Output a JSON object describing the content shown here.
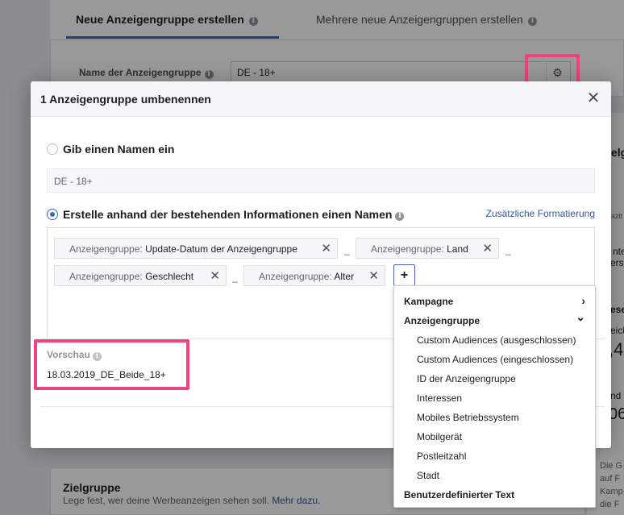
{
  "background": {
    "tabs": [
      {
        "label": "Neue Anzeigengruppe erstellen"
      },
      {
        "label": "Mehrere neue Anzeigengruppen erstellen"
      }
    ],
    "name_label": "Name der Anzeigengruppe",
    "name_value": "DE - 18+",
    "zielgruppe_title": "Zielgruppe",
    "zielgruppe_sub": "Lege fest, wer deine Werbeanzeigen sehen soll.",
    "zielgruppe_link": "Mehr dazu.",
    "right_fragments": [
      "elg",
      "azit",
      "nte",
      "erso",
      "ese",
      "eich",
      ",4",
      "nd",
      "06",
      "Die G",
      "auf F",
      "Kamp",
      "die F"
    ]
  },
  "modal": {
    "title": "1 Anzeigengruppe umbenennen",
    "option_manual_label": "Gib einen Namen ein",
    "manual_placeholder": "DE - 18+",
    "option_auto_label": "Erstelle anhand der bestehenden Informationen einen Namen",
    "extra_format_link": "Zusätzliche Formatierung",
    "tokens": [
      {
        "key": "Anzeigengruppe:",
        "value": "Update-Datum der Anzeigengruppe"
      },
      {
        "key": "Anzeigengruppe:",
        "value": "Land"
      },
      {
        "key": "Anzeigengruppe:",
        "value": "Geschlecht"
      },
      {
        "key": "Anzeigengruppe:",
        "value": "Alter"
      }
    ],
    "separator": "_",
    "add_label": "+",
    "preview_label": "Vorschau",
    "preview_value": "18.03.2019_DE_Beide_18+"
  },
  "dropdown": {
    "sections": [
      {
        "label": "Kampagne",
        "chevron": "›"
      },
      {
        "label": "Anzeigengruppe",
        "chevron": "⌄"
      }
    ],
    "items": [
      "Custom Audiences (ausgeschlossen)",
      "Custom Audiences (eingeschlossen)",
      "ID der Anzeigengruppe",
      "Interessen",
      "Mobiles Betriebssystem",
      "Mobilgerät",
      "Postleitzahl",
      "Stadt"
    ],
    "custom_text": "Benutzerdefinierter Text"
  },
  "colors": {
    "highlight": "#f0427c",
    "accent": "#4267b2",
    "link": "#365899"
  }
}
